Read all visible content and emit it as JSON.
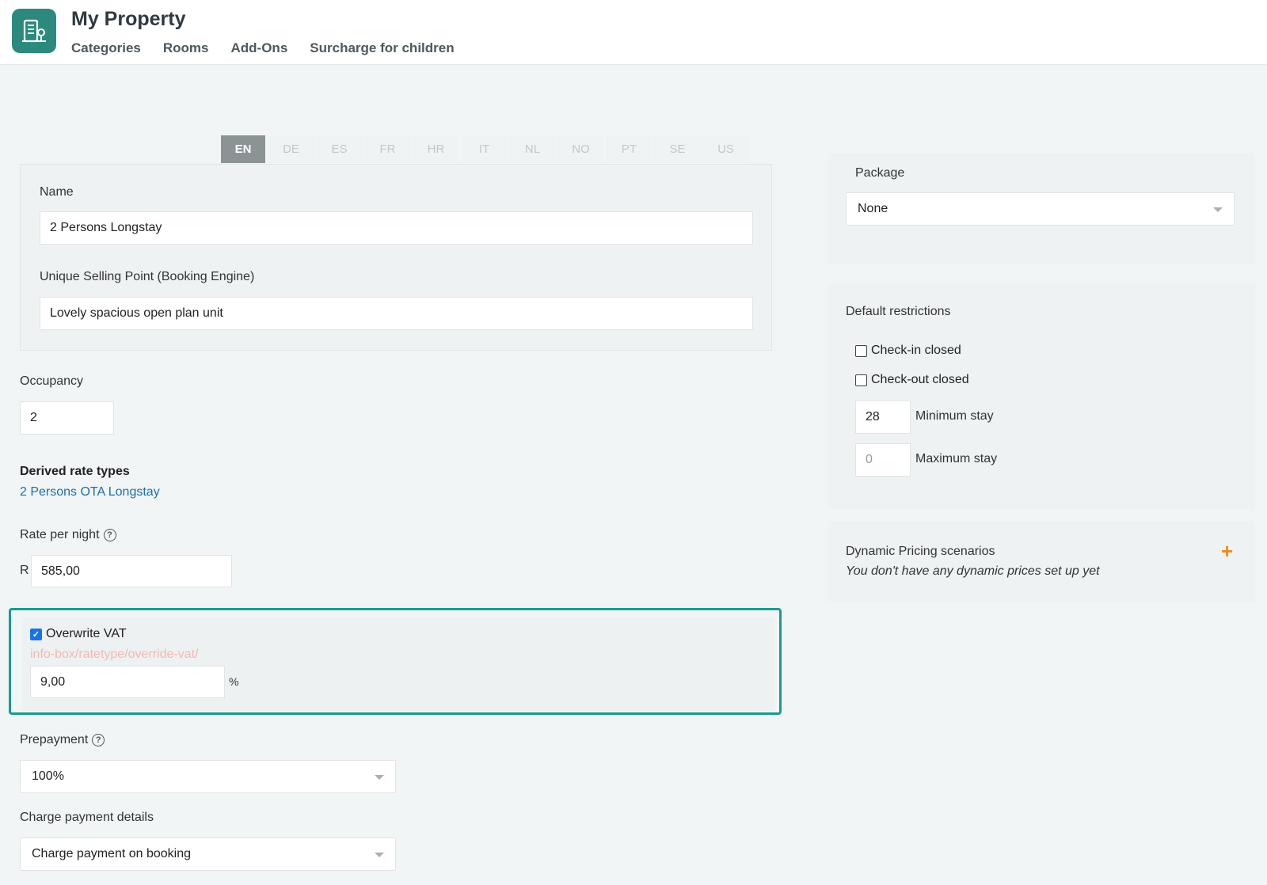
{
  "header": {
    "title": "My Property",
    "nav": [
      "Categories",
      "Rooms",
      "Add-Ons",
      "Surcharge for children"
    ]
  },
  "languages": [
    "EN",
    "DE",
    "ES",
    "FR",
    "HR",
    "IT",
    "NL",
    "NO",
    "PT",
    "SE",
    "US"
  ],
  "active_language": "EN",
  "form": {
    "name_label": "Name",
    "name_value": "2 Persons Longstay",
    "usp_label": "Unique Selling Point (Booking Engine)",
    "usp_value": "Lovely spacious open plan unit",
    "occupancy_label": "Occupancy",
    "occupancy_value": "2",
    "derived_label": "Derived rate types",
    "derived_link": "2 Persons OTA Longstay",
    "rate_label": "Rate per night",
    "rate_help_icon": "question-circle-icon",
    "currency": "R",
    "rate_value": "585,00",
    "overwrite_vat_label": "Overwrite VAT",
    "overwrite_vat_checked": true,
    "vat_info_key": "info-box/ratetype/override-vat/",
    "vat_value": "9,00",
    "vat_unit": "%",
    "prepayment_label": "Prepayment",
    "prepayment_value": "100%",
    "charge_label": "Charge payment details",
    "charge_value": "Charge payment on booking"
  },
  "sidebar": {
    "package_label": "Package",
    "package_value": "None",
    "restrictions_title": "Default restrictions",
    "checkin_closed_label": "Check-in closed",
    "checkout_closed_label": "Check-out closed",
    "min_stay_value": "28",
    "min_stay_label": "Minimum stay",
    "max_stay_placeholder": "0",
    "max_stay_label": "Maximum stay",
    "dynamic_title": "Dynamic Pricing scenarios",
    "dynamic_empty": "You don't have any dynamic prices set up yet"
  },
  "colors": {
    "brand": "#2b8a7d",
    "highlight_border": "#1a9c8f",
    "link": "#1e6ea8",
    "accent_plus": "#f08c1e",
    "info_key_text": "#f4b8b4"
  }
}
